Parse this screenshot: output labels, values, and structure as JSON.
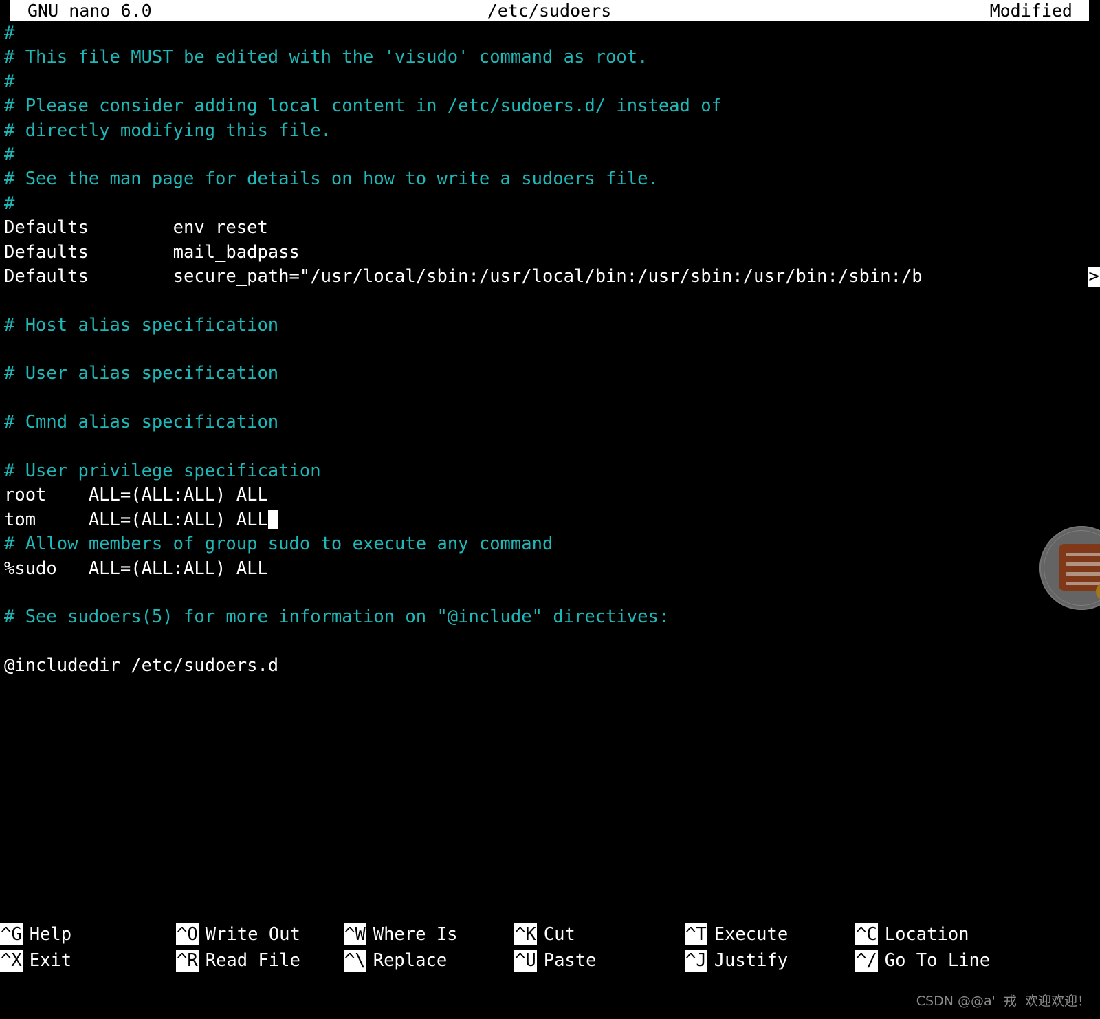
{
  "titlebar": {
    "app": "GNU nano 6.0",
    "filename": "/etc/sudoers",
    "state": "Modified"
  },
  "editor": {
    "lines": [
      {
        "text": "#",
        "type": "comment"
      },
      {
        "text": "# This file MUST be edited with the 'visudo' command as root.",
        "type": "comment"
      },
      {
        "text": "#",
        "type": "comment"
      },
      {
        "text": "# Please consider adding local content in /etc/sudoers.d/ instead of",
        "type": "comment"
      },
      {
        "text": "# directly modifying this file.",
        "type": "comment"
      },
      {
        "text": "#",
        "type": "comment"
      },
      {
        "text": "# See the man page for details on how to write a sudoers file.",
        "type": "comment"
      },
      {
        "text": "#",
        "type": "comment"
      },
      {
        "text": "Defaults        env_reset",
        "type": "code"
      },
      {
        "text": "Defaults        mail_badpass",
        "type": "code"
      },
      {
        "text": "Defaults        secure_path=\"/usr/local/sbin:/usr/local/bin:/usr/sbin:/usr/bin:/sbin:/b",
        "type": "code",
        "truncated": true,
        "truncation_marker": ">"
      },
      {
        "text": "",
        "type": "code"
      },
      {
        "text": "# Host alias specification",
        "type": "comment"
      },
      {
        "text": "",
        "type": "code"
      },
      {
        "text": "# User alias specification",
        "type": "comment"
      },
      {
        "text": "",
        "type": "code"
      },
      {
        "text": "# Cmnd alias specification",
        "type": "comment"
      },
      {
        "text": "",
        "type": "code"
      },
      {
        "text": "# User privilege specification",
        "type": "comment"
      },
      {
        "text": "root    ALL=(ALL:ALL) ALL",
        "type": "code"
      },
      {
        "text": "tom     ALL=(ALL:ALL) ALL",
        "type": "code",
        "cursor_at_end": true
      },
      {
        "text": "# Allow members of group sudo to execute any command",
        "type": "comment"
      },
      {
        "text": "%sudo   ALL=(ALL:ALL) ALL",
        "type": "code"
      },
      {
        "text": "",
        "type": "code"
      },
      {
        "text": "# See sudoers(5) for more information on \"@include\" directives:",
        "type": "comment"
      },
      {
        "text": "",
        "type": "code"
      },
      {
        "text": "@includedir /etc/sudoers.d",
        "type": "code"
      }
    ]
  },
  "shortcuts": {
    "row1": [
      {
        "key": "^G",
        "label": "Help"
      },
      {
        "key": "^O",
        "label": "Write Out"
      },
      {
        "key": "^W",
        "label": "Where Is"
      },
      {
        "key": "^K",
        "label": "Cut"
      },
      {
        "key": "^T",
        "label": "Execute"
      },
      {
        "key": "^C",
        "label": "Location"
      }
    ],
    "row2": [
      {
        "key": "^X",
        "label": "Exit"
      },
      {
        "key": "^R",
        "label": "Read File"
      },
      {
        "key": "^\\",
        "label": "Replace"
      },
      {
        "key": "^U",
        "label": "Paste"
      },
      {
        "key": "^J",
        "label": "Justify"
      },
      {
        "key": "^/",
        "label": "Go To Line"
      }
    ]
  },
  "watermark": {
    "text": "CSDN @@a'  戎  欢迎欢迎！"
  },
  "colors": {
    "background": "#000000",
    "foreground": "#ffffff",
    "comment": "#1fb8b8",
    "titlebar_bg": "#ffffff",
    "titlebar_fg": "#000000",
    "watermark": "#8a8a8a"
  },
  "float_widget": {
    "icon": "document-icon",
    "circle_color": "#6d6d6d",
    "doc_color": "#8a3d1b"
  }
}
